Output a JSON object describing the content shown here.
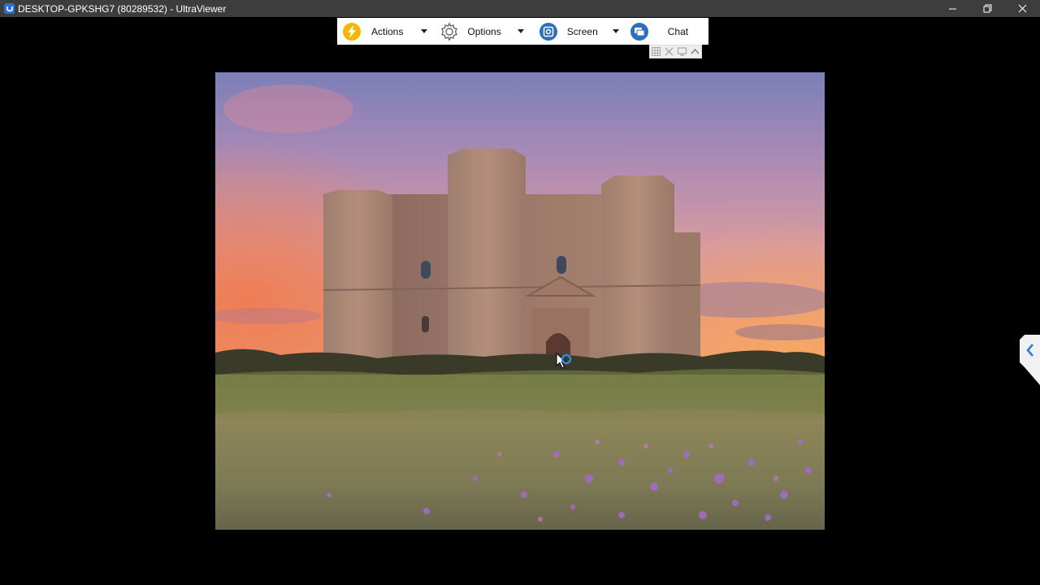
{
  "window": {
    "title": "DESKTOP-GPKSHG7 (80289532) - UltraViewer",
    "controls": [
      "minimize-icon",
      "restore-icon",
      "close-icon"
    ]
  },
  "toolbar": {
    "items": [
      {
        "label": "Actions",
        "icon": "lightning-icon",
        "has_menu": true
      },
      {
        "label": "Options",
        "icon": "gear-icon",
        "has_menu": true
      },
      {
        "label": "Screen",
        "icon": "screen-icon",
        "has_menu": true
      },
      {
        "label": "Chat",
        "icon": "chat-icon",
        "has_menu": false
      }
    ],
    "mini_controls": [
      "grid-icon",
      "fullscreen-icon",
      "monitor-icon",
      "collapse-icon"
    ]
  },
  "remote_screen": {
    "content": "castle-photo",
    "cursor": "busy-cursor-icon"
  },
  "side_panel": {
    "toggle_icon": "chevron-left-icon"
  },
  "colors": {
    "titlebar": "#3d3d3d",
    "background": "#000000",
    "toolbar": "#ffffff",
    "accent_blue": "#2b6fd6",
    "actions_icon": "#f2b705"
  }
}
